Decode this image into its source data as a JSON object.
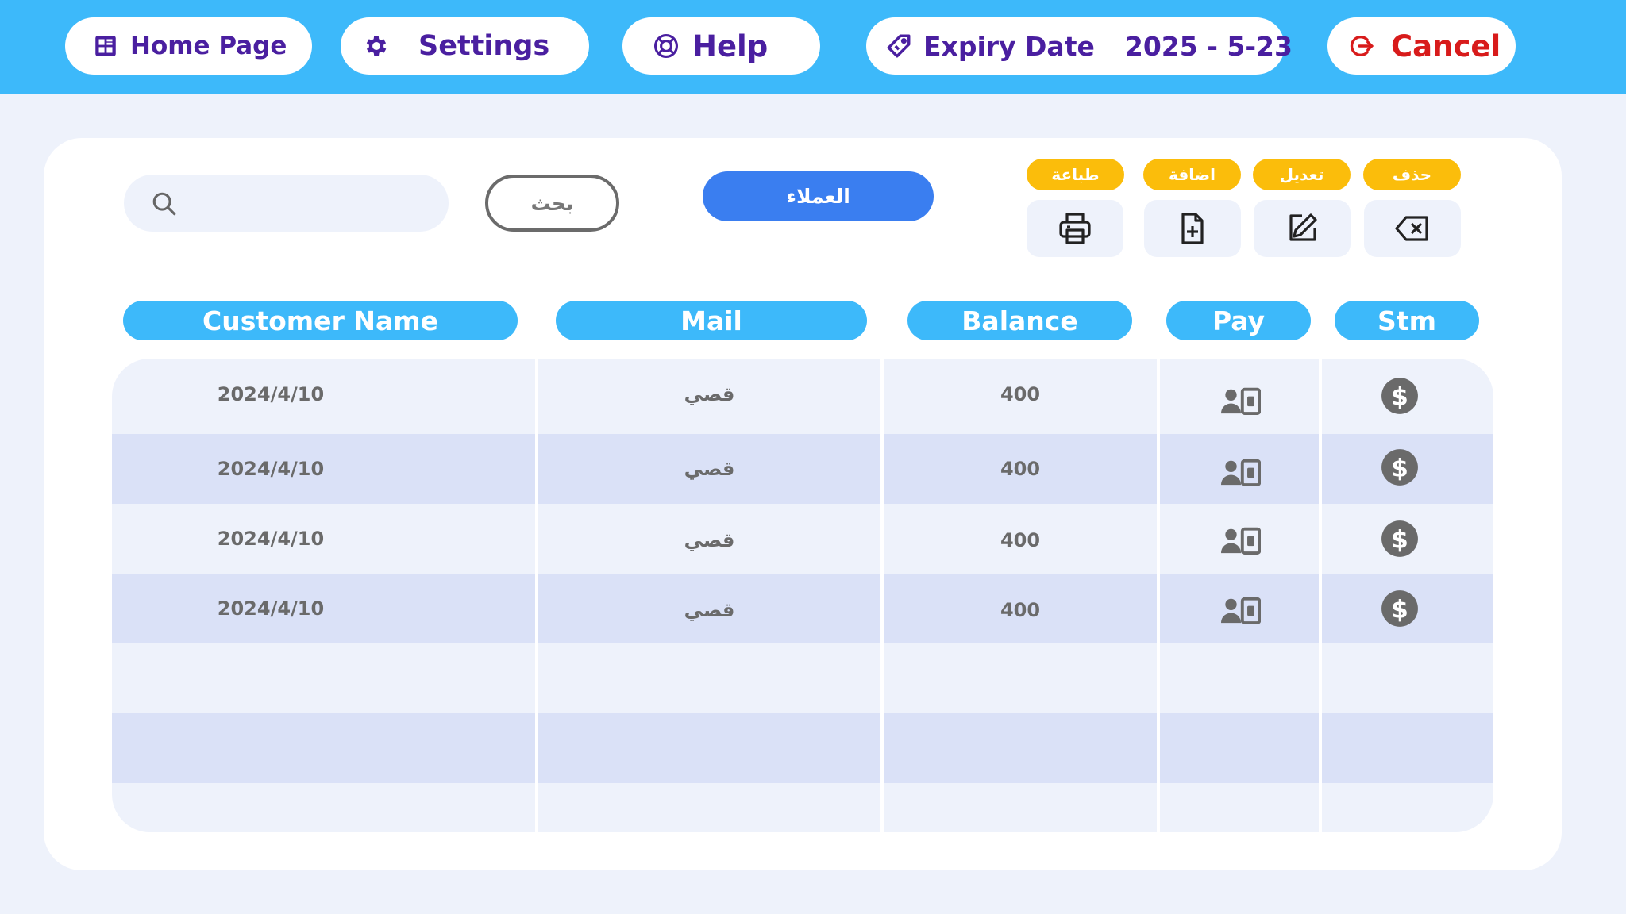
{
  "nav": {
    "home": {
      "label": "Home Page",
      "icon": "home-grid-icon"
    },
    "settings": {
      "label": "Settings",
      "icon": "gear-icon"
    },
    "help": {
      "label": "Help",
      "icon": "lifebuoy-icon"
    },
    "expiry": {
      "label": "Expiry Date",
      "date": "2025 - 5-23",
      "icon": "tag-icon"
    },
    "cancel": {
      "label": "Cancel",
      "icon": "logout-icon"
    }
  },
  "toolbar": {
    "search_placeholder": "",
    "search_button": "بحث",
    "customers_button": "العملاء",
    "actions": [
      {
        "tag": "طباعة",
        "icon": "printer-icon"
      },
      {
        "tag": "اضافة",
        "icon": "add-file-icon"
      },
      {
        "tag": "تعديل",
        "icon": "edit-icon"
      },
      {
        "tag": "حذف",
        "icon": "delete-icon"
      }
    ]
  },
  "table": {
    "headers": [
      "Customer Name",
      "Mail",
      "Balance",
      "Pay",
      "Stm"
    ],
    "rows": [
      {
        "customer": "2024/4/10",
        "mail": "قصي",
        "balance": "400"
      },
      {
        "customer": "2024/4/10",
        "mail": "قصي",
        "balance": "400"
      },
      {
        "customer": "2024/4/10",
        "mail": "قصي",
        "balance": "400"
      },
      {
        "customer": "2024/4/10",
        "mail": "قصي",
        "balance": "400"
      }
    ],
    "pay_icon": "user-payment-icon",
    "stm_icon": "dollar-coin-icon"
  },
  "colors": {
    "accent": "#3db9fa",
    "primary_button": "#3a7ef0",
    "tag": "#fbbd0b",
    "nav_text": "#4a1fa0",
    "cancel_text": "#d81b1b",
    "background": "#eef2fb"
  }
}
